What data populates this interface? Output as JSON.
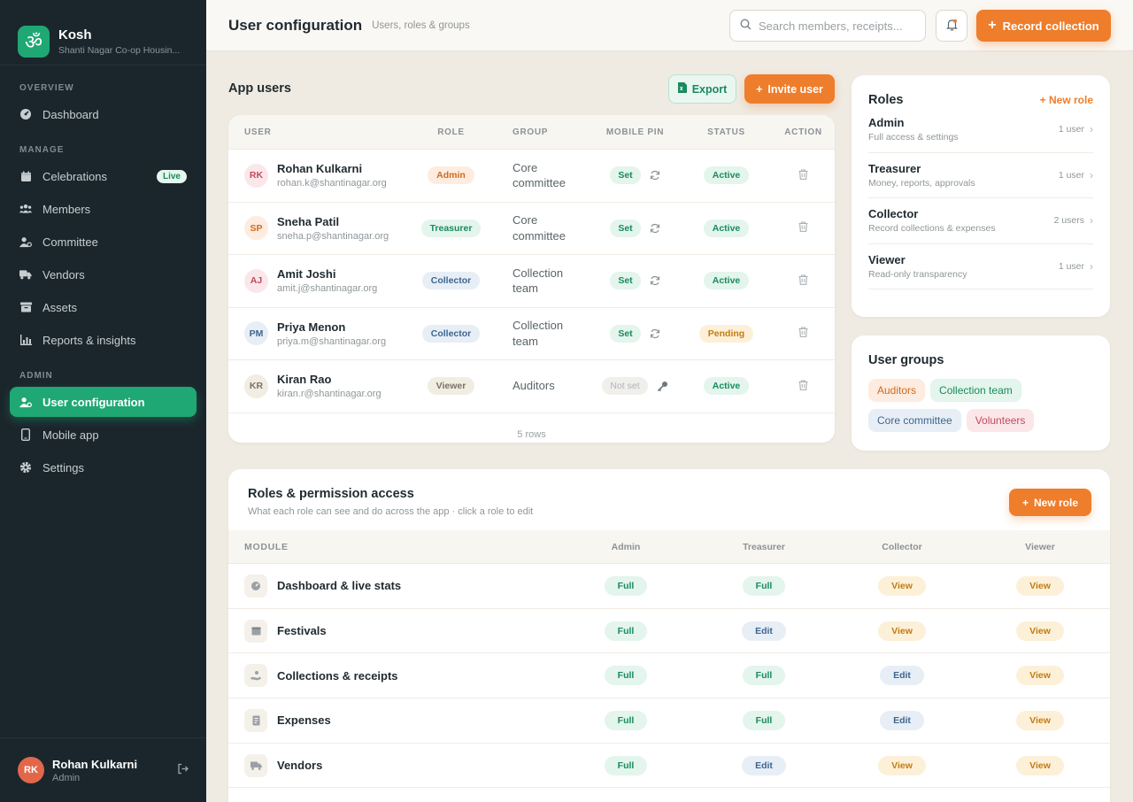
{
  "brand": {
    "logo": "ॐ",
    "name": "Kosh",
    "subtitle": "Shanti Nagar Co-op Housin..."
  },
  "nav": {
    "overview_label": "OVERVIEW",
    "manage_label": "MANAGE",
    "admin_label": "ADMIN",
    "dashboard": "Dashboard",
    "celebrations": "Celebrations",
    "live_badge": "Live",
    "members": "Members",
    "committee": "Committee",
    "vendors": "Vendors",
    "assets": "Assets",
    "reports": "Reports & insights",
    "user_config": "User configuration",
    "mobile_app": "Mobile app",
    "settings": "Settings"
  },
  "sidebar_user": {
    "initials": "RK",
    "name": "Rohan Kulkarni",
    "role": "Admin"
  },
  "topbar": {
    "title": "User configuration",
    "subtitle": "Users, roles & groups",
    "search_placeholder": "Search members, receipts...",
    "record_label": "Record collection"
  },
  "app_users": {
    "title": "App users",
    "export_label": "Export",
    "invite_label": "Invite user",
    "columns": {
      "user": "USER",
      "role": "ROLE",
      "group": "GROUP",
      "pin": "MOBILE PIN",
      "status": "STATUS",
      "action": "ACTION"
    },
    "rows": [
      {
        "initials": "RK",
        "name": "Rohan Kulkarni",
        "email": "rohan.k@shantinagar.org",
        "role": "Admin",
        "group": "Core committee",
        "pin": "Set",
        "status": "Active"
      },
      {
        "initials": "SP",
        "name": "Sneha Patil",
        "email": "sneha.p@shantinagar.org",
        "role": "Treasurer",
        "group": "Core committee",
        "pin": "Set",
        "status": "Active"
      },
      {
        "initials": "AJ",
        "name": "Amit Joshi",
        "email": "amit.j@shantinagar.org",
        "role": "Collector",
        "group": "Collection team",
        "pin": "Set",
        "status": "Active"
      },
      {
        "initials": "PM",
        "name": "Priya Menon",
        "email": "priya.m@shantinagar.org",
        "role": "Collector",
        "group": "Collection team",
        "pin": "Set",
        "status": "Pending"
      },
      {
        "initials": "KR",
        "name": "Kiran Rao",
        "email": "kiran.r@shantinagar.org",
        "role": "Viewer",
        "group": "Auditors",
        "pin": "Not set",
        "status": "Active"
      }
    ],
    "rows_count": "5 rows"
  },
  "roles": {
    "title": "Roles",
    "new_label": "New role",
    "items": [
      {
        "name": "Admin",
        "desc": "Full access & settings",
        "count": "1 user"
      },
      {
        "name": "Treasurer",
        "desc": "Money, reports, approvals",
        "count": "1 user"
      },
      {
        "name": "Collector",
        "desc": "Record collections & expenses",
        "count": "2 users"
      },
      {
        "name": "Viewer",
        "desc": "Read-only transparency",
        "count": "1 user"
      }
    ]
  },
  "groups": {
    "title": "User groups",
    "tags": [
      "Auditors",
      "Collection team",
      "Core committee",
      "Volunteers"
    ]
  },
  "permissions": {
    "title": "Roles & permission access",
    "subtitle": "What each role can see and do across the app · click a role to edit",
    "new_label": "New role",
    "columns": {
      "module": "MODULE",
      "admin": "Admin",
      "treasurer": "Treasurer",
      "collector": "Collector",
      "viewer": "Viewer"
    },
    "rows": [
      {
        "module": "Dashboard & live stats",
        "icon": "gauge-icon",
        "admin": "Full",
        "treasurer": "Full",
        "collector": "View",
        "viewer": "View"
      },
      {
        "module": "Festivals",
        "icon": "calendar-icon",
        "admin": "Full",
        "treasurer": "Edit",
        "collector": "View",
        "viewer": "View"
      },
      {
        "module": "Collections & receipts",
        "icon": "hand-coin-icon",
        "admin": "Full",
        "treasurer": "Full",
        "collector": "Edit",
        "viewer": "View"
      },
      {
        "module": "Expenses",
        "icon": "receipt-icon",
        "admin": "Full",
        "treasurer": "Full",
        "collector": "Edit",
        "viewer": "View"
      },
      {
        "module": "Vendors",
        "icon": "truck-icon",
        "admin": "Full",
        "treasurer": "Edit",
        "collector": "View",
        "viewer": "View"
      }
    ]
  },
  "colors": {
    "accent": "#ee7d2c",
    "primary": "#1fa874",
    "sidebar": "#1b262c",
    "background": "#efebe3"
  }
}
